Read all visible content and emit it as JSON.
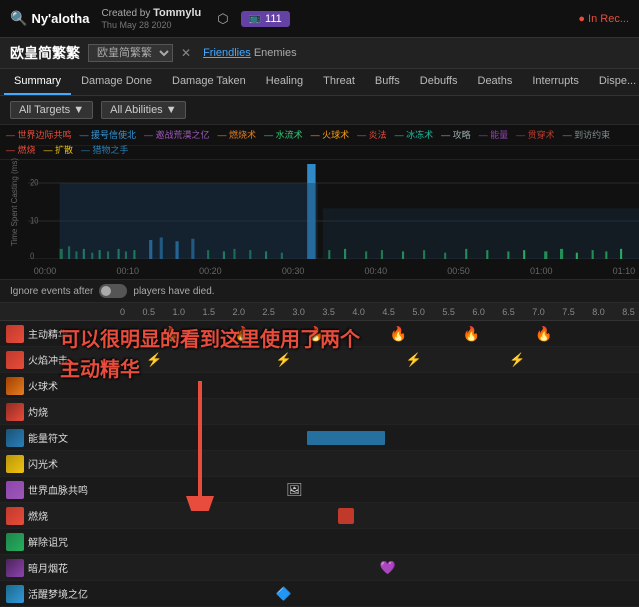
{
  "topbar": {
    "logo": "Ny'alotha",
    "created_label": "Created by",
    "author": "Tommylu",
    "date": "Thu May 28 2020",
    "twitch_count": "111",
    "in_rec": "In Rec..."
  },
  "titlebar": {
    "boss_name": "欧皇简繁繁",
    "lang_label": "欧皇简繁繁 ▼",
    "friendlies": "Friendlies",
    "enemies": "Enemies"
  },
  "nav": {
    "tabs": [
      "Summary",
      "Damage Done",
      "Damage Taken",
      "Healing",
      "Threat",
      "Buffs",
      "Debuffs",
      "Deaths",
      "Interrupts",
      "Dispe..."
    ]
  },
  "filters": {
    "targets_label": "All Targets ▼",
    "abilities_label": "All Abilities ▼"
  },
  "chart": {
    "y_label": "Time Spent Casting (ms)",
    "x_ticks": [
      "00:00",
      "00:10",
      "00:20",
      "00:30",
      "00:40",
      "00:50",
      "01:00",
      "01:10"
    ],
    "legend": [
      "世界边际共鸣",
      "援号信使北",
      "邀战荒漠之亿",
      "·燃烧术",
      "水流术",
      "火球术",
      "·炎法",
      "冰冻术",
      "·攻略",
      "·能量",
      "·贯穿术",
      "到访约束",
      "·燃烧",
      "·扩散",
      "·猎物之手"
    ]
  },
  "ignore_bar": {
    "text_before": "Ignore events after",
    "text_after": "players have died."
  },
  "ruler": {
    "marks": [
      "0",
      "0.5",
      "1.0",
      "1.5",
      "2.0",
      "2.5",
      "3.0",
      "3.5",
      "4.0",
      "4.5",
      "5.0",
      "5.5",
      "6.0",
      "6.5",
      "7.0",
      "7.5",
      "8.0",
      "8.5"
    ]
  },
  "abilities": [
    {
      "name": "主动精华",
      "icon_class": "icon-fire",
      "color": "#e67e22"
    },
    {
      "name": "火焰冲击",
      "icon_class": "icon-fire",
      "color": "#e74c3c"
    },
    {
      "name": "火球术",
      "icon_class": "icon-orange",
      "color": "#e67e22"
    },
    {
      "name": "灼烧",
      "icon_class": "icon-fire",
      "color": "#c0392b"
    },
    {
      "name": "能量符文",
      "icon_class": "icon-arcane",
      "color": "#2980b9"
    },
    {
      "name": "闪光术",
      "icon_class": "icon-holy",
      "color": "#f1c40f"
    },
    {
      "name": "世界血脉共鸣",
      "icon_class": "icon-lightning",
      "color": "#9b59b6"
    },
    {
      "name": "燃烧",
      "icon_class": "icon-fire",
      "color": "#e74c3c"
    },
    {
      "name": "解除诅咒",
      "icon_class": "icon-nature",
      "color": "#27ae60"
    },
    {
      "name": "暗月烟花",
      "icon_class": "icon-shadow",
      "color": "#8e44ad"
    },
    {
      "name": "活醒梦境之亿",
      "icon_class": "icon-frost",
      "color": "#3498db"
    }
  ],
  "annotation": {
    "chinese_text": "可以很明显的看到这里使用了两个\n主动精华",
    "line1": "可以很明显的看到这里使用了两个",
    "line2": "主动精华"
  }
}
